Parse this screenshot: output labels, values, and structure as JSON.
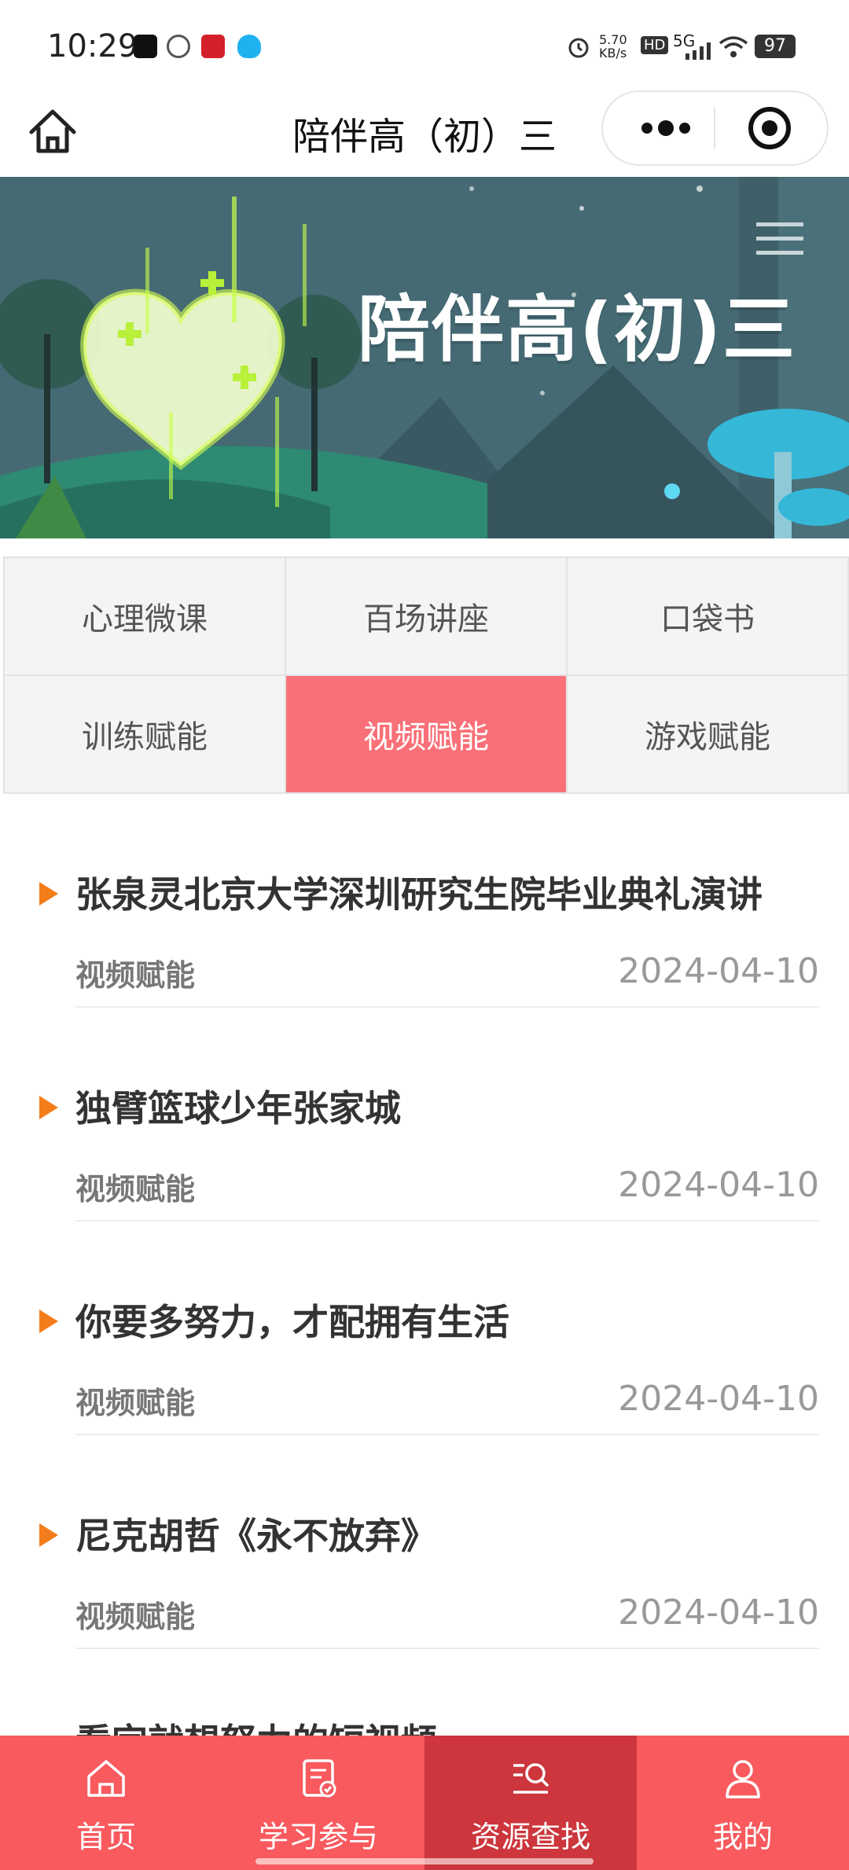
{
  "status_bar": {
    "time": "10:29",
    "network_speed": "5.70 KB/s",
    "hd": "HD",
    "signal": "5G",
    "battery": "97"
  },
  "title_bar": {
    "title": "陪伴高（初）三",
    "home_icon": "home-icon",
    "more_icon": "more-dots-icon",
    "close_icon": "target-circle-icon"
  },
  "banner": {
    "title": "陪伴高(初)三",
    "menu_icon": "hamburger-menu-icon"
  },
  "categories": [
    {
      "label": "心理微课"
    },
    {
      "label": "百场讲座"
    },
    {
      "label": "口袋书"
    },
    {
      "label": "训练赋能"
    },
    {
      "label": "视频赋能"
    },
    {
      "label": "游戏赋能"
    }
  ],
  "active_category": "视频赋能",
  "items": [
    {
      "title": "张泉灵北京大学深圳研究生院毕业典礼演讲",
      "tag": "视频赋能",
      "date": "2024-04-10"
    },
    {
      "title": "独臂篮球少年张家城",
      "tag": "视频赋能",
      "date": "2024-04-10"
    },
    {
      "title": "你要多努力，才配拥有生活",
      "tag": "视频赋能",
      "date": "2024-04-10"
    },
    {
      "title": "尼克胡哲《永不放弃》",
      "tag": "视频赋能",
      "date": "2024-04-10"
    }
  ],
  "partial_item_title": "看完就想努力的短视频",
  "nav": [
    {
      "label": "首页",
      "icon": "home-icon"
    },
    {
      "label": "学习参与",
      "icon": "clipboard-check-icon"
    },
    {
      "label": "资源查找",
      "icon": "search-list-icon"
    },
    {
      "label": "我的",
      "icon": "user-icon"
    }
  ],
  "colors": {
    "accent": "#fa7078",
    "nav_bg": "#f85a5e",
    "nav_active": "#cc363c",
    "arrow": "#f37d1a"
  }
}
